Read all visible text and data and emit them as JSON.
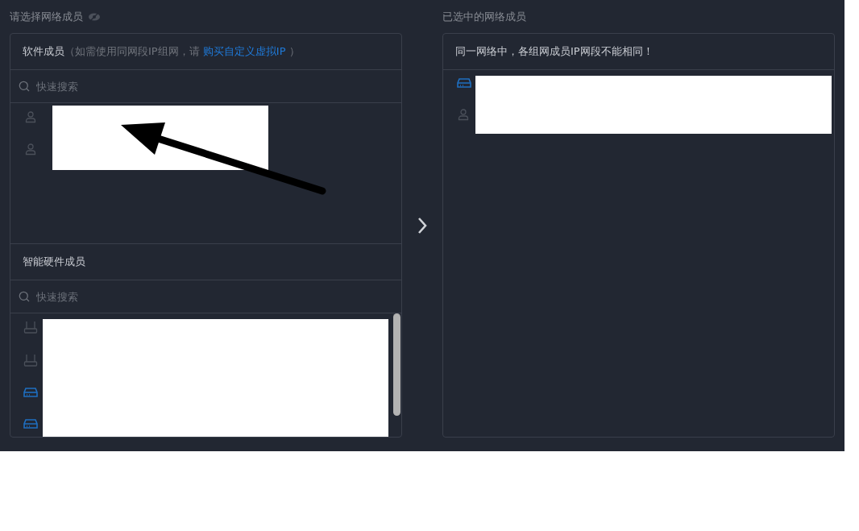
{
  "left": {
    "title": "请选择网络成员",
    "software": {
      "title": "软件成员",
      "note_before": "（如需使用同网段IP组网，请 ",
      "link": "购买自定义虚拟IP",
      "note_after": " ）",
      "search": {
        "placeholder": "快速搜索"
      },
      "members": [
        {
          "kind": "person"
        },
        {
          "kind": "person"
        }
      ]
    },
    "hardware": {
      "title": "智能硬件成员",
      "search": {
        "placeholder": "快速搜索"
      },
      "members": [
        {
          "kind": "router"
        },
        {
          "kind": "router"
        },
        {
          "kind": "device"
        },
        {
          "kind": "device"
        }
      ]
    }
  },
  "right": {
    "title": "已选中的网络成员",
    "notice": "同一网络中，各组网成员IP网段不能相同！",
    "members": [
      {
        "kind": "device"
      },
      {
        "kind": "person"
      }
    ]
  }
}
